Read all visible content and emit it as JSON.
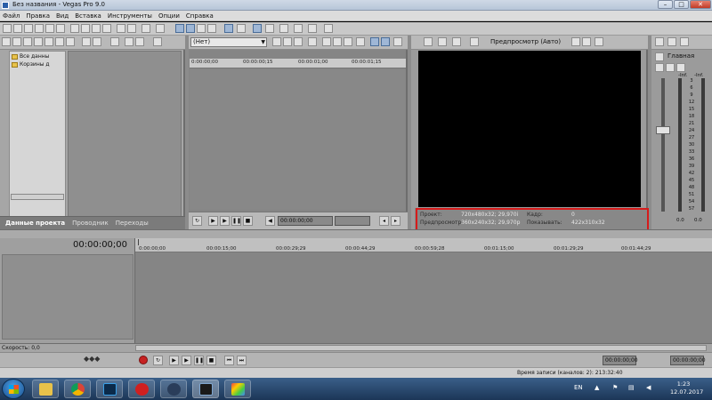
{
  "window": {
    "title": "Без названия - Vegas Pro 9.0",
    "min": "–",
    "max": "□",
    "close": "✕"
  },
  "menu": [
    "Файл",
    "Правка",
    "Вид",
    "Вставка",
    "Инструменты",
    "Опции",
    "Справка"
  ],
  "explorer": {
    "tree": [
      "Все данны",
      "Корзины д"
    ],
    "tabs": [
      "Данные проекта",
      "Проводник",
      "Переходы"
    ]
  },
  "trimmer": {
    "select": "(Нет)",
    "ruler": [
      "0:00:00;00",
      "00:00:00;15",
      "00:00:01;00",
      "00:00:01;15"
    ],
    "timecode": "00:00:00;00"
  },
  "preview": {
    "mode_label": "Предпросмотр (Авто)",
    "project_label": "Проект:",
    "project_value": "720x480x32; 29,970i",
    "preview_label": "Предпросмотр:",
    "preview_value": "360x240x32; 29,970p",
    "frame_label": "Кадр:",
    "frame_value": "0",
    "display_label": "Показывать:",
    "display_value": "422x310x32"
  },
  "master": {
    "label": "Главная",
    "inf_left": "-Inf.",
    "inf_right": "-Inf.",
    "scale": [
      "3",
      "6",
      "9",
      "12",
      "15",
      "18",
      "21",
      "24",
      "27",
      "30",
      "33",
      "36",
      "39",
      "42",
      "45",
      "48",
      "51",
      "54",
      "57"
    ],
    "bottom_left": "0.0",
    "bottom_right": "0.0"
  },
  "timeline": {
    "timecode": "00:00:00;00",
    "ruler": [
      "0:00:00;00",
      "00:00:15;00",
      "00:00:29;29",
      "00:00:44;29",
      "00:00:59;28",
      "00:01:15;00",
      "00:01:29;29",
      "00:01:44;29"
    ],
    "speed": "Скорость: 0,0",
    "record_time": "Время записи (каналов: 2): 213:32:40",
    "tc_field_1": "00:00:00;00",
    "tc_field_2": "00:00:00;00"
  },
  "taskbar": {
    "lang": "EN",
    "time": "1:23",
    "date": "12.07.2017",
    "apps": [
      "folder-icon",
      "chrome-icon",
      "photoshop-icon",
      "record-icon",
      "cinema4d-icon",
      "vegas-icon",
      "paint-icon"
    ]
  },
  "colors": {
    "highlight": "#d61b1b",
    "panel": "#8c8c8c",
    "taskbar": "#1c3657"
  }
}
